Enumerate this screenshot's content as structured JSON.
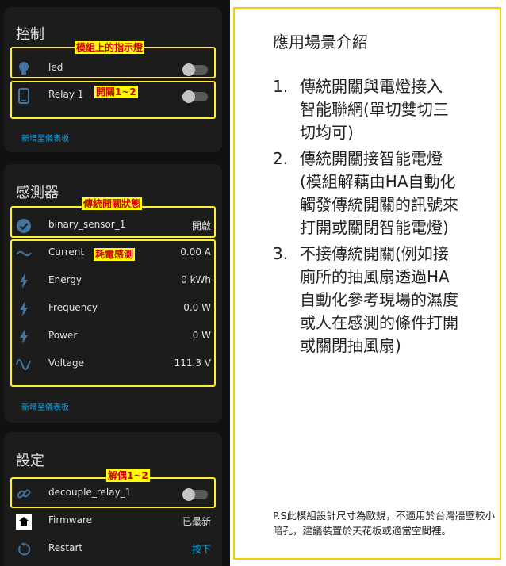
{
  "control_card": {
    "title": "控制",
    "rows": [
      {
        "label": "led"
      },
      {
        "label": "Relay 1"
      }
    ],
    "add_link": "新增至儀表板"
  },
  "sensor_card": {
    "title": "感測器",
    "rows": [
      {
        "label": "binary_sensor_1",
        "value": "開啟"
      },
      {
        "label": "Current",
        "value": "0.00 A"
      },
      {
        "label": "Energy",
        "value": "0 kWh"
      },
      {
        "label": "Frequency",
        "value": "0.0 W"
      },
      {
        "label": "Power",
        "value": "0 W"
      },
      {
        "label": "Voltage",
        "value": "111.3 V"
      }
    ],
    "add_link": "新增至儀表板"
  },
  "settings_card": {
    "title": "設定",
    "rows": [
      {
        "label": "decouple_relay_1"
      },
      {
        "label": "Firmware",
        "value": "已最新"
      },
      {
        "label": "Restart",
        "value": "按下"
      }
    ]
  },
  "annotations": {
    "led_tag": "模組上的指示燈",
    "relay_tag": "開關1~2",
    "binary_tag": "傳統開關狀態",
    "power_tag": "耗電感測",
    "decouple_tag": "解偶1~2"
  },
  "explanation": {
    "title": "應用場景介紹",
    "items": [
      {
        "num": "1.",
        "text": "傳統開關與電燈接入智能聯網(單切雙切三切均可)"
      },
      {
        "num": "2.",
        "text": "傳統開關接智能電燈(模組解藕由HA自動化觸發傳統開關的訊號來打開或關閉智能電燈)"
      },
      {
        "num": "3.",
        "text": "不接傳統開關(例如接廁所的抽風扇透過HA自動化參考現場的濕度或人在感測的條件打開或關閉抽風扇)"
      }
    ],
    "note": "P.S此模組設計尺寸為歐規，不適用於台灣牆壁較小暗孔，建議裝置於天花板或適當空間裡。"
  },
  "colors": {
    "accent": "#03a9f4",
    "highlight": "#ffee33",
    "tag_bg": "#ffff00",
    "tag_text": "#cc0000"
  }
}
